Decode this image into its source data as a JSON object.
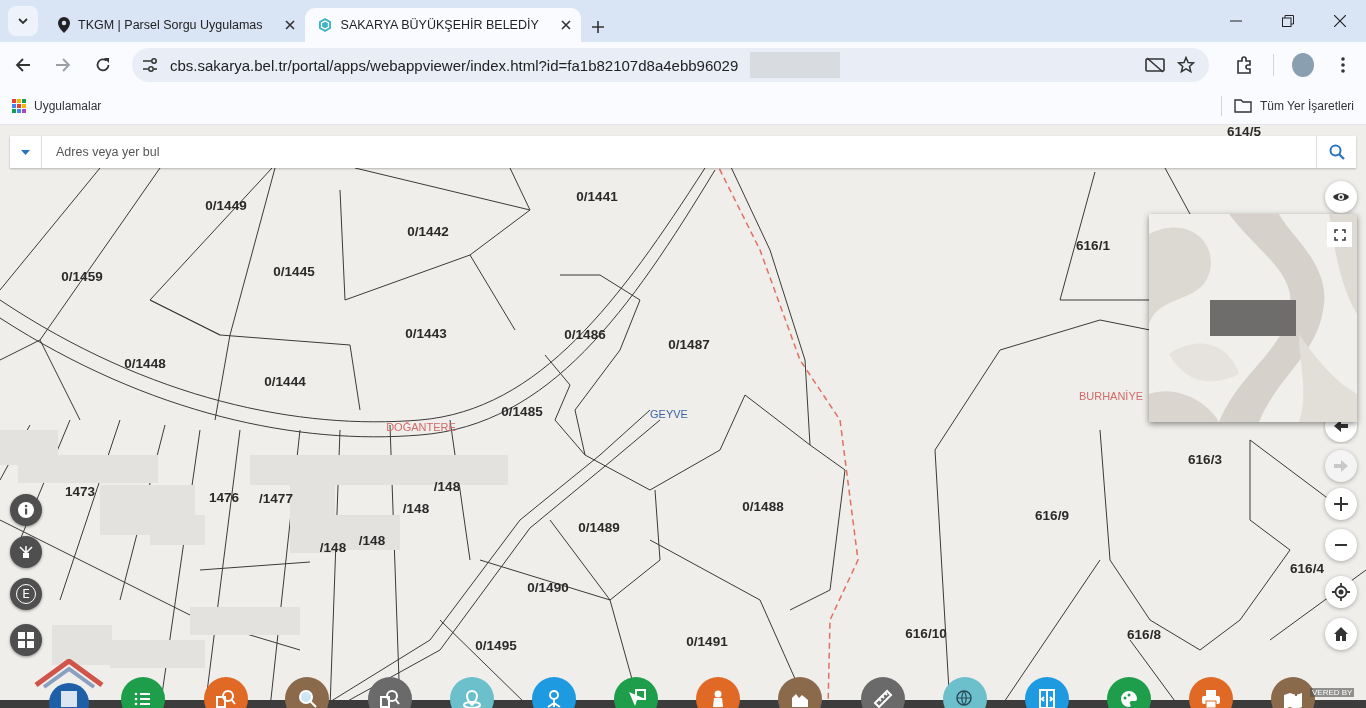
{
  "tabs": [
    {
      "title": "TKGM | Parsel Sorgu Uygulamas",
      "selected": false,
      "kind": "pin"
    },
    {
      "title": "SAKARYA BÜYÜKŞEHİR BELEDİY",
      "selected": true,
      "kind": "logo"
    }
  ],
  "address_bar": {
    "url": "cbs.sakarya.bel.tr/portal/apps/webappviewer/index.html?id=fa1b82107d8a4ebb96029"
  },
  "bookmarks_bar": {
    "apps": "Uygulamalar",
    "all_bookmarks": "Tüm Yer İşaretleri"
  },
  "search": {
    "placeholder": "Adres veya yer bul"
  },
  "map": {
    "parcels": [
      {
        "label": "614/5"
      },
      {
        "label": "0/1449"
      },
      {
        "label": "0/1441"
      },
      {
        "label": "0/1442"
      },
      {
        "label": "0/1459"
      },
      {
        "label": "0/1445"
      },
      {
        "label": "0/1486"
      },
      {
        "label": "0/1487"
      },
      {
        "label": "0/1443"
      },
      {
        "label": "0/1448"
      },
      {
        "label": "0/1444"
      },
      {
        "label": "0/1485"
      },
      {
        "label": "1473"
      },
      {
        "label": "1476"
      },
      {
        "label": "/1477"
      },
      {
        "label": "/148"
      },
      {
        "label": "/148"
      },
      {
        "label": "/148"
      },
      {
        "label": "/148"
      },
      {
        "label": "0/1489"
      },
      {
        "label": "0/1488"
      },
      {
        "label": "0/1490"
      },
      {
        "label": "0/1495"
      },
      {
        "label": "0/1491"
      },
      {
        "label": "616/1"
      },
      {
        "label": "616/3"
      },
      {
        "label": "616/9"
      },
      {
        "label": "616/4"
      },
      {
        "label": "616/10"
      },
      {
        "label": "616/8"
      }
    ],
    "places": [
      {
        "label": "DOĞANTERE",
        "color": "#d26a6a"
      },
      {
        "label": "GEYVE",
        "color": "#3a64a8"
      },
      {
        "label": "BURHANİYE",
        "color": "#d26a6a"
      }
    ]
  },
  "left_tools": [
    {
      "kind": "info"
    },
    {
      "kind": "network"
    },
    {
      "kind": "letter",
      "text": "E"
    },
    {
      "kind": "grid"
    }
  ],
  "right_controls": [
    {
      "kind": "eye",
      "disabled": false
    },
    {
      "kind": "previous",
      "disabled": false
    },
    {
      "kind": "next",
      "disabled": true
    },
    {
      "kind": "zoom-in",
      "disabled": false
    },
    {
      "kind": "zoom-out",
      "disabled": false
    },
    {
      "kind": "locate",
      "disabled": false
    },
    {
      "kind": "home",
      "disabled": false
    }
  ],
  "toolbar": [
    {
      "kind": "list",
      "color": "#1e9e4a"
    },
    {
      "kind": "doc-search",
      "color": "#e06a25"
    },
    {
      "kind": "magnifier",
      "color": "#8a6a4a"
    },
    {
      "kind": "doc-search",
      "color": "#6a6a6a"
    },
    {
      "kind": "pin",
      "color": "#6cc0cc"
    },
    {
      "kind": "node",
      "color": "#1e9ae0"
    },
    {
      "kind": "cursor",
      "color": "#1e9e4a"
    },
    {
      "kind": "person",
      "color": "#e06a25"
    },
    {
      "kind": "profile",
      "color": "#8a6a4a"
    },
    {
      "kind": "ruler",
      "color": "#6a6a6a"
    },
    {
      "kind": "globe",
      "color": "#6cc0cc"
    },
    {
      "kind": "compare",
      "color": "#1e9ae0"
    },
    {
      "kind": "palette",
      "color": "#1e9e4a"
    },
    {
      "kind": "printer",
      "color": "#e06a25"
    },
    {
      "kind": "map-add",
      "color": "#8a6a4a"
    }
  ],
  "attribution": "VERED BY"
}
